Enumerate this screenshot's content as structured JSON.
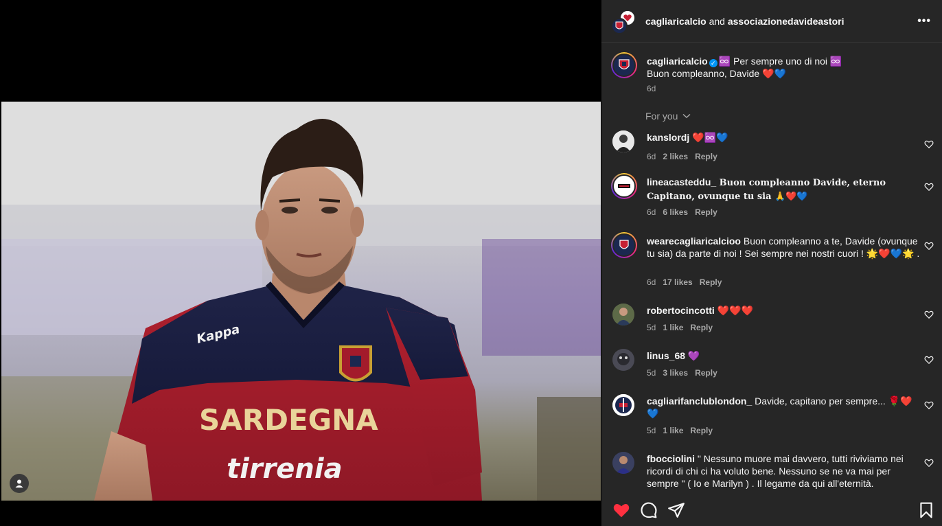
{
  "header": {
    "user1": "cagliaricalcio",
    "connector": "and",
    "user2": "associazionedavideastori",
    "more_label": "•••"
  },
  "caption": {
    "username": "cagliaricalcio",
    "line1": "♾️ Per sempre uno di noi ♾️",
    "line2": "Buon compleanno, Davide ❤️💙",
    "time": "6d"
  },
  "sort": {
    "label": "For you"
  },
  "comments": [
    {
      "user": "kanslordj",
      "text": " ❤️♾️💙",
      "time": "6d",
      "likes": "2 likes",
      "reply": "Reply"
    },
    {
      "user": "lineacasteddu_",
      "text": " Buon compleanno Davide, eterno Capitano, ovunque tu sia 🙏❤️💙",
      "time": "6d",
      "likes": "6 likes",
      "reply": "Reply"
    },
    {
      "user": "wearecagliaricalcioo",
      "text": " Buon compleanno a te, Davide (ovunque tu sia) da parte di noi ! Sei sempre nei nostri cuori ! 🌟❤️💙🌟 .",
      "time": "6d",
      "likes": "17 likes",
      "reply": "Reply"
    },
    {
      "user": "robertocincotti",
      "text": " ❤️❤️❤️",
      "time": "5d",
      "likes": "1 like",
      "reply": "Reply"
    },
    {
      "user": "linus_68",
      "text": " 💜",
      "time": "5d",
      "likes": "3 likes",
      "reply": "Reply"
    },
    {
      "user": "cagliarifanclublondon_",
      "text": " Davide, capitano per sempre... 🌹❤️💙",
      "time": "5d",
      "likes": "1 like",
      "reply": "Reply"
    },
    {
      "user": "fbocciolini",
      "text": " \" Nessuno muore mai davvero, tutti riviviamo nei ricordi di chi ci ha voluto bene. Nessuno se ne va mai per sempre \" ( Io e Marilyn ) . Il legame da qui all'eternità.",
      "time": "",
      "likes": "",
      "reply": ""
    }
  ],
  "photo": {
    "jersey_sponsor": "SARDEGNA",
    "jersey_sponsor2": "tirrenia",
    "jersey_brand": "Kappa"
  },
  "colors": {
    "panel_bg": "#262626",
    "like_red": "#ff3040",
    "verified_blue": "#0095f6"
  }
}
